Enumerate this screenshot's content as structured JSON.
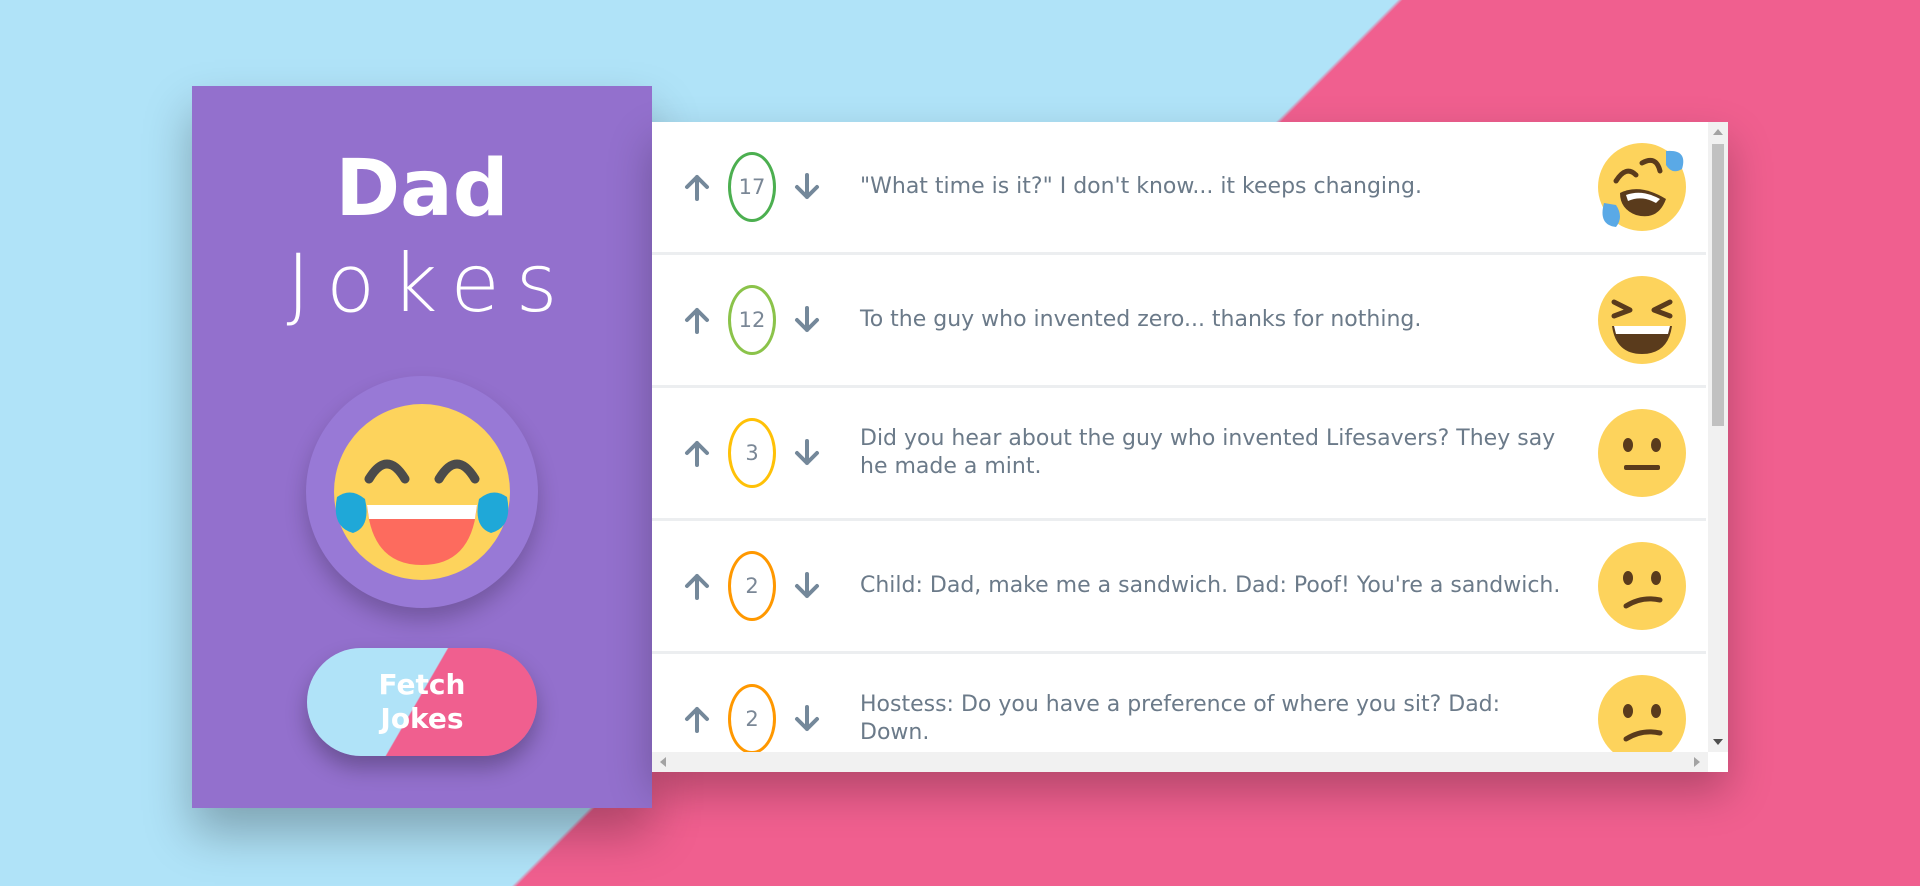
{
  "sidebar": {
    "title_line1": "Dad",
    "title_line2": "Jokes",
    "logo_icon": "laughing-tears-emoji",
    "fetch_button_label": "Fetch Jokes"
  },
  "colors": {
    "background_left": "#b0e3f8",
    "background_right": "#f05f8f",
    "sidebar": "#9370cd",
    "text": "#6b7a89"
  },
  "jokes": [
    {
      "score": "17",
      "text": "\"What time is it?\" I don't know... it keeps changing.",
      "emoji": "rolling-on-floor-laughing",
      "border_color": "#4caf50"
    },
    {
      "score": "12",
      "text": "To the guy who invented zero... thanks for nothing.",
      "emoji": "grinning-squinting",
      "border_color": "#8bc34a"
    },
    {
      "score": "3",
      "text": "Did you hear about the guy who invented Lifesavers? They say he made a mint.",
      "emoji": "neutral-face",
      "border_color": "#ffc107"
    },
    {
      "score": "2",
      "text": "Child: Dad, make me a sandwich. Dad: Poof! You're a sandwich.",
      "emoji": "confused-face",
      "border_color": "#ff9800"
    },
    {
      "score": "2",
      "text": "Hostess: Do you have a preference of where you sit? Dad: Down.",
      "emoji": "confused-face",
      "border_color": "#ff9800"
    }
  ]
}
